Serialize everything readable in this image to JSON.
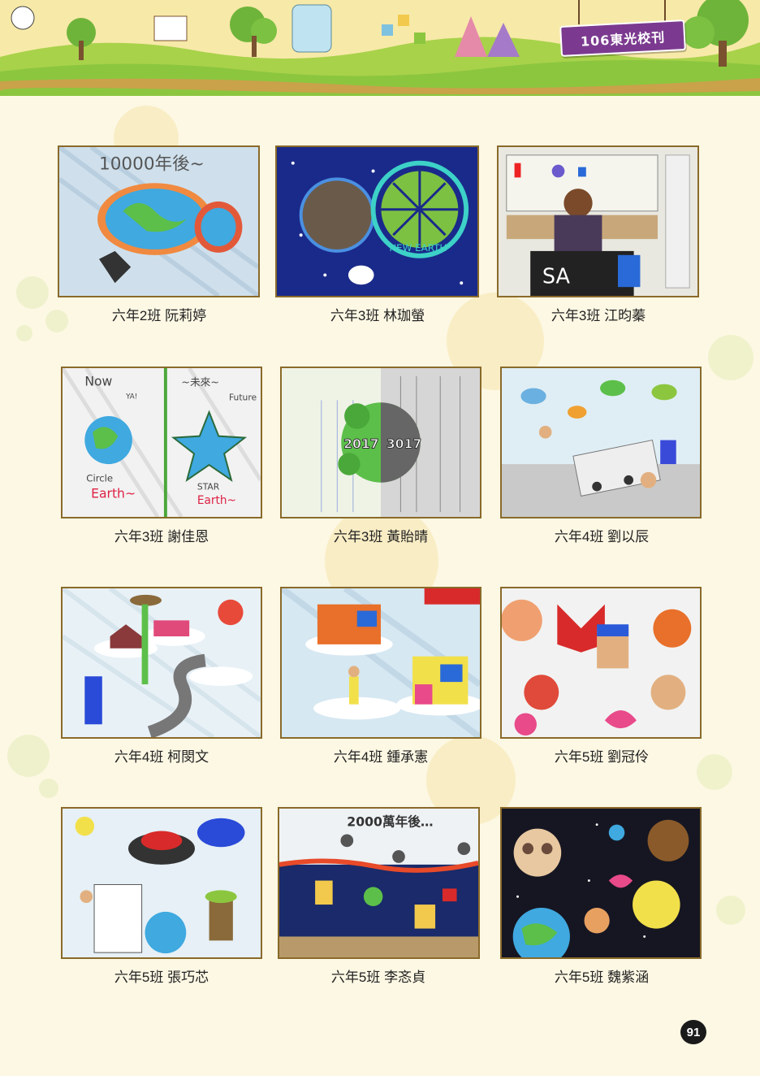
{
  "header": {
    "title": "106東光校刊"
  },
  "artworks": [
    {
      "caption": "六年2班 阮莉婷",
      "theme": "earth-10000-years"
    },
    {
      "caption": "六年3班 林珈螢",
      "theme": "planets-new-earth"
    },
    {
      "caption": "六年3班 江昀蓁",
      "theme": "classroom-screen"
    },
    {
      "caption": "六年3班 謝佳恩",
      "theme": "now-future-earth-star"
    },
    {
      "caption": "六年3班 黃貽晴",
      "theme": "2017-3017-earth"
    },
    {
      "caption": "六年4班 劉以辰",
      "theme": "future-city"
    },
    {
      "caption": "六年4班 柯閔文",
      "theme": "cloud-houses-road"
    },
    {
      "caption": "六年4班 鍾承憲",
      "theme": "houses-on-clouds"
    },
    {
      "caption": "六年5班 劉冠伶",
      "theme": "faces-hearts"
    },
    {
      "caption": "六年5班 張巧芯",
      "theme": "sky-ships-book"
    },
    {
      "caption": "六年5班 李忞貞",
      "theme": "meteors-city"
    },
    {
      "caption": "六年5班 魏紫涵",
      "theme": "space-animals"
    }
  ],
  "artwork_texts": {
    "earth_title": "10000年後~",
    "new_earth": "NEW EARTH",
    "classroom_sign": "SA",
    "now": "Now",
    "ya": "YA!",
    "future_header": "~未來~",
    "future": "Future",
    "circle_earth_1": "Circle",
    "circle_earth_2": "Earth~",
    "star_earth_1": "STAR",
    "star_earth_2": "Earth~",
    "year_a": "2017",
    "year_b": "3017",
    "meteor_title": "2000萬年後…"
  },
  "page_number": "91",
  "colors": {
    "background": "#fdf8e4",
    "frame_border": "#8a6a2a",
    "title_tag": "#7b3a8f",
    "grass": "#8cc63f"
  }
}
